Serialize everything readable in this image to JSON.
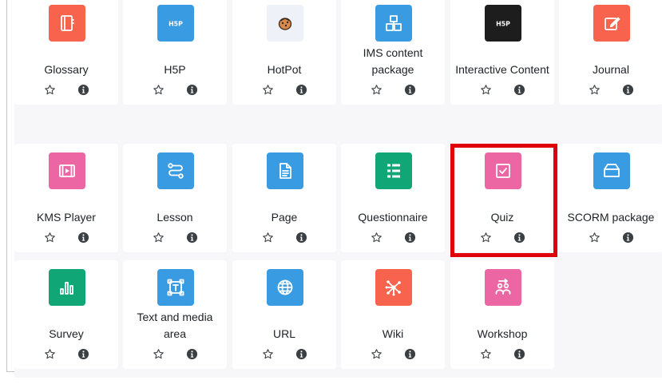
{
  "modules": [
    {
      "name": "Glossary",
      "icon": "book-icon",
      "color": "#f7634d"
    },
    {
      "name": "H5P",
      "icon": "h5p-logo-icon",
      "color": "#399be2"
    },
    {
      "name": "HotPot",
      "icon": "hotpot-icon",
      "color": "#eef1f7"
    },
    {
      "name": "IMS content package",
      "icon": "package-icon",
      "color": "#399be2"
    },
    {
      "name": "Interactive Content",
      "icon": "h5p-logo-icon",
      "color": "#1d1d1d"
    },
    {
      "name": "Journal",
      "icon": "pencil-square-icon",
      "color": "#f7634d"
    },
    {
      "name": "KMS Player",
      "icon": "video-player-icon",
      "color": "#eb66a2"
    },
    {
      "name": "Lesson",
      "icon": "lesson-path-icon",
      "color": "#399be2"
    },
    {
      "name": "Page",
      "icon": "document-icon",
      "color": "#399be2"
    },
    {
      "name": "Questionnaire",
      "icon": "list-icon",
      "color": "#11a676"
    },
    {
      "name": "Quiz",
      "icon": "checkbox-icon",
      "color": "#eb66a2"
    },
    {
      "name": "SCORM package",
      "icon": "box-icon",
      "color": "#399be2"
    },
    {
      "name": "Survey",
      "icon": "bar-chart-icon",
      "color": "#11a676"
    },
    {
      "name": "Text and media area",
      "icon": "text-frame-icon",
      "color": "#399be2"
    },
    {
      "name": "URL",
      "icon": "globe-icon",
      "color": "#399be2"
    },
    {
      "name": "Wiki",
      "icon": "network-icon",
      "color": "#f7634d"
    },
    {
      "name": "Workshop",
      "icon": "people-icon",
      "color": "#eb66a2"
    }
  ],
  "actions": {
    "star_icon": "star-outline-icon",
    "info_icon": "info-icon"
  },
  "highlight_color": "#e0000a"
}
